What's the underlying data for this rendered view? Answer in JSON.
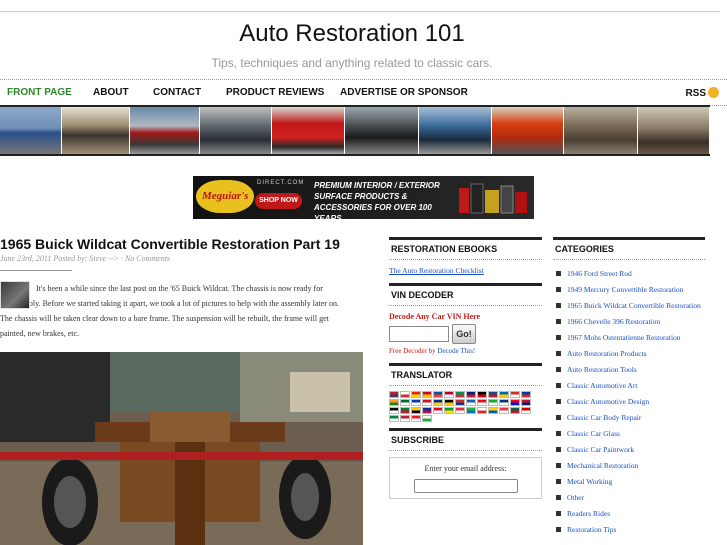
{
  "site": {
    "title": "Auto Restoration 101",
    "tagline": "Tips, techniques and anything related to classic cars."
  },
  "nav": {
    "items": [
      {
        "label": "FRONT PAGE",
        "active": true
      },
      {
        "label": "ABOUT",
        "active": false
      },
      {
        "label": "CONTACT",
        "active": false
      },
      {
        "label": "PRODUCT REVIEWS",
        "active": false
      },
      {
        "label": "ADVERTISE OR SPONSOR",
        "active": false
      }
    ],
    "rss_label": "RSS"
  },
  "banner_ad": {
    "brand": "Meguiar's",
    "domain": "DIRECT.COM",
    "cta": "SHOP NOW",
    "copy_line1": "PREMIUM INTERIOR / EXTERIOR",
    "copy_line2": "SURFACE PRODUCTS &",
    "copy_line3": "ACCESSORIES FOR OVER 100 YEARS"
  },
  "post": {
    "title": "1965 Buick Wildcat Convertible Restoration Part 19",
    "meta": "June 23rd, 2011 Posted by: Steve --> ·",
    "comments": "No Comments",
    "body": "It's been a while since the last post on the '65 Buick Wildcat. The chassis is now ready for disassembly. Before we started taking it apart, we took a lot of pictures to help with the assembly later on. The chassis will be taken clear down to a bare frame. The suspension will be rebuilt, the frame will get painted, new brakes, etc."
  },
  "sidebar": {
    "ebooks": {
      "title": "RESTORATION EBOOKS",
      "link": "The Auto Restoration Checklist"
    },
    "vin": {
      "title": "VIN DECODER",
      "heading": "Decode Any Car VIN Here",
      "button": "Go!",
      "note": "Free Decoder by",
      "note_link": "Decode This!"
    },
    "translator": {
      "title": "TRANSLATOR"
    },
    "subscribe": {
      "title": "SUBSCRIBE",
      "prompt": "Enter your email address:"
    },
    "categories": {
      "title": "CATEGORIES",
      "items": [
        "1946 Ford Street Rod",
        "1949 Mercury Convertible Restoration",
        "1965 Buick Wildcat Convertible Restoration",
        "1966 Chevelle 396 Restoration",
        "1967 Mohs Ostentatienne Restoration",
        "Auto Restoration Products",
        "Auto Restoration Tools",
        "Classic Automotive Art",
        "Classic Automotive Design",
        "Classic Car Body Repair",
        "Classic Car Glass",
        "Classic Car Paintwork",
        "Mechanical Restoration",
        "Metal Working",
        "Other",
        "Readers Rides",
        "Restoration Tips"
      ]
    }
  },
  "colors": {
    "nav_active": "#2a8a2a",
    "link": "#1a4fc0",
    "vin_red": "#c0201a"
  }
}
